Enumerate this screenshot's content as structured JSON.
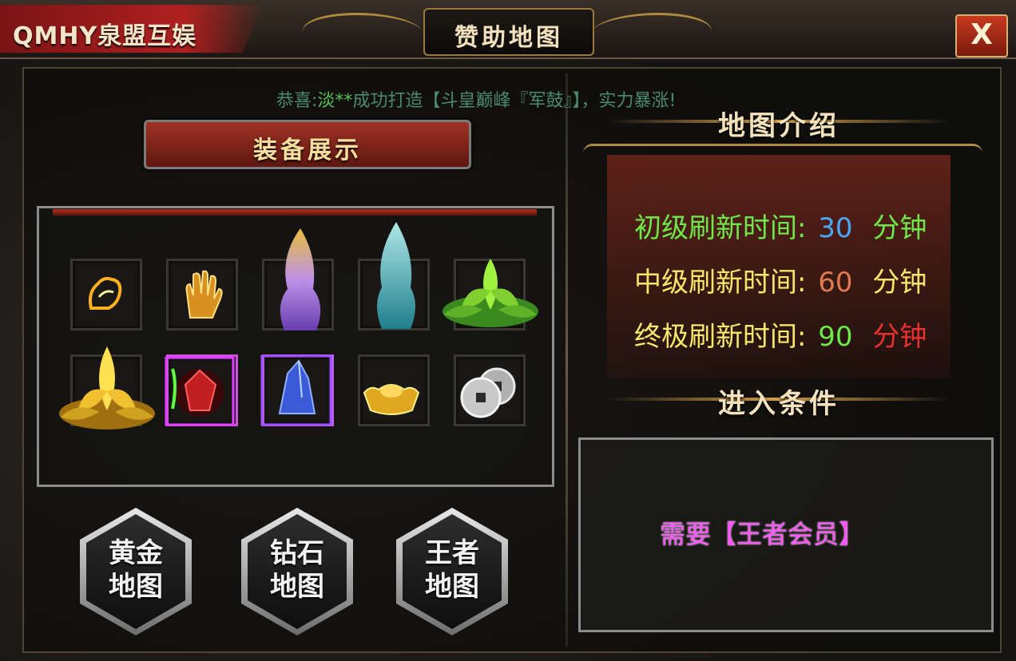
{
  "header": {
    "logo": "QMHY泉盟互娱",
    "title": "赞助地图",
    "close_label": "X"
  },
  "broadcast": {
    "prefix": "恭喜:",
    "player": "淡**",
    "message": "成功打造【斗皇巅峰『军鼓』】，实力暴涨!"
  },
  "equipment": {
    "title": "装备展示",
    "items_row1": [
      "flame-fist-icon",
      "golden-palm-icon",
      "purple-flame-icon",
      "cyan-flame-icon",
      "green-lotus-icon"
    ],
    "items_row2": [
      "golden-lotus-icon",
      "red-gem-icon",
      "blue-crystal-icon",
      "gold-ingot-icon",
      "coins-icon"
    ]
  },
  "map_buttons": [
    {
      "line1": "黄金",
      "line2": "地图"
    },
    {
      "line1": "钻石",
      "line2": "地图"
    },
    {
      "line1": "王者",
      "line2": "地图"
    }
  ],
  "intro": {
    "title": "地图介绍",
    "rows": [
      {
        "label": "初级刷新时间:",
        "value": "30",
        "unit": "分钟",
        "label_color": "#6ee84a",
        "value_color": "#4aa8f0",
        "unit_color": "#6ee84a"
      },
      {
        "label": "中级刷新时间:",
        "value": "60",
        "unit": "分钟",
        "label_color": "#f5e86a",
        "value_color": "#e07a50",
        "unit_color": "#f5e86a"
      },
      {
        "label": "终极刷新时间:",
        "value": "90",
        "unit": "分钟",
        "label_color": "#f5e86a",
        "value_color": "#6ee84a",
        "unit_color": "#e83030"
      }
    ]
  },
  "conditions": {
    "title": "进入条件",
    "req_prefix": "需要",
    "req_value": "【王者会员】"
  }
}
